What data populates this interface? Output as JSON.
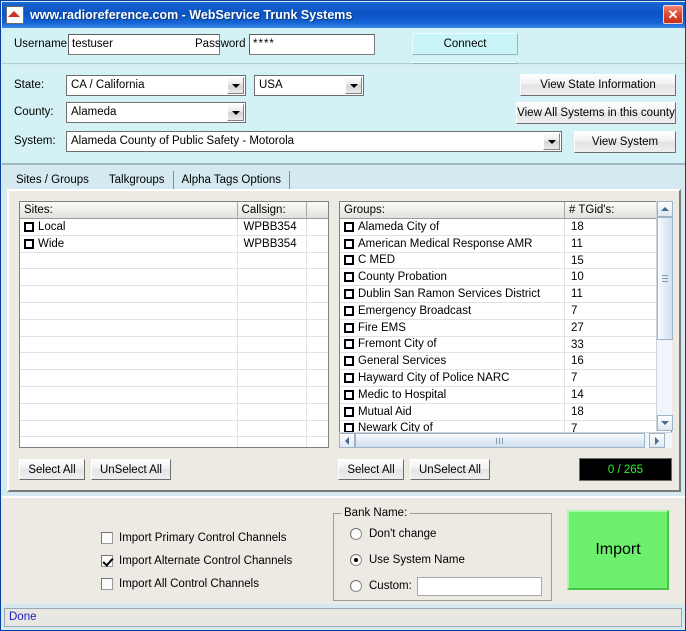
{
  "window": {
    "title": "www.radioreference.com - WebService Trunk Systems",
    "close_label": "✕",
    "app_icon": "radioreference-logo-icon"
  },
  "login": {
    "username_label": "Username:",
    "username_value": "testuser",
    "username_placeholder": "",
    "password_label": "Password",
    "password_value": "****",
    "password_placeholder": "",
    "connect_label": "Connect",
    "connect_color": "#c9f5f8"
  },
  "selectors": {
    "state_label": "State:",
    "state_value": "CA / California",
    "country_value": "USA",
    "county_label": "County:",
    "county_value": "Alameda",
    "system_label": "System:",
    "system_value": "Alameda  County of  Public Safety  - Motorola",
    "view_state_label": "View State Information",
    "view_all_systems_label": "View All Systems in this county",
    "view_system_label": "View System"
  },
  "tabs": [
    {
      "label": "Sites / Groups",
      "active": true
    },
    {
      "label": "Talkgroups",
      "active": false
    },
    {
      "label": "Alpha Tags Options",
      "active": false
    }
  ],
  "sites_list": {
    "columns": [
      "Sites:",
      "Callsign:",
      ""
    ],
    "rows": [
      {
        "name": "Local",
        "callsign": "WPBB354",
        "checked": false
      },
      {
        "name": "Wide",
        "callsign": "WPBB354",
        "checked": false
      }
    ],
    "select_all_label": "Select All",
    "unselect_all_label": "UnSelect All"
  },
  "groups_list": {
    "columns": [
      "Groups:",
      "# TGid's:"
    ],
    "rows": [
      {
        "name": "Alameda  City of",
        "tgids": "18",
        "checked": false
      },
      {
        "name": "American Medical Response  AMR",
        "tgids": "11",
        "checked": false
      },
      {
        "name": "C MED",
        "tgids": "15",
        "checked": false
      },
      {
        "name": "County Probation",
        "tgids": "10",
        "checked": false
      },
      {
        "name": "Dublin San Ramon Services District",
        "tgids": "11",
        "checked": false
      },
      {
        "name": "Emergency Broadcast",
        "tgids": "7",
        "checked": false
      },
      {
        "name": "Fire EMS",
        "tgids": "27",
        "checked": false
      },
      {
        "name": "Fremont  City of",
        "tgids": "33",
        "checked": false
      },
      {
        "name": "General Services",
        "tgids": "16",
        "checked": false
      },
      {
        "name": "Hayward  City of Police  NARC",
        "tgids": "7",
        "checked": false
      },
      {
        "name": "Medic to Hospital",
        "tgids": "14",
        "checked": false
      },
      {
        "name": "Mutual Aid",
        "tgids": "18",
        "checked": false
      },
      {
        "name": "Newark  City of",
        "tgids": "7",
        "checked": false
      }
    ],
    "select_all_label": "Select All",
    "unselect_all_label": "UnSelect All",
    "counter": "0 / 265",
    "counter_color": "#2ef22e"
  },
  "import_options": {
    "primary_label": "Import Primary Control Channels",
    "primary_checked": false,
    "alternate_label": "Import Alternate Control Channels",
    "alternate_checked": true,
    "all_label": "Import All Control Channels",
    "all_checked": false
  },
  "bank_name": {
    "title": "Bank Name:",
    "options": [
      {
        "label": "Don't change",
        "selected": false
      },
      {
        "label": "Use System Name",
        "selected": true
      },
      {
        "label": "Custom:",
        "selected": false
      }
    ],
    "custom_value": "",
    "custom_placeholder": ""
  },
  "import_button": {
    "label": "Import",
    "color": "#6df06d"
  },
  "statusbar": {
    "text": "Done"
  }
}
